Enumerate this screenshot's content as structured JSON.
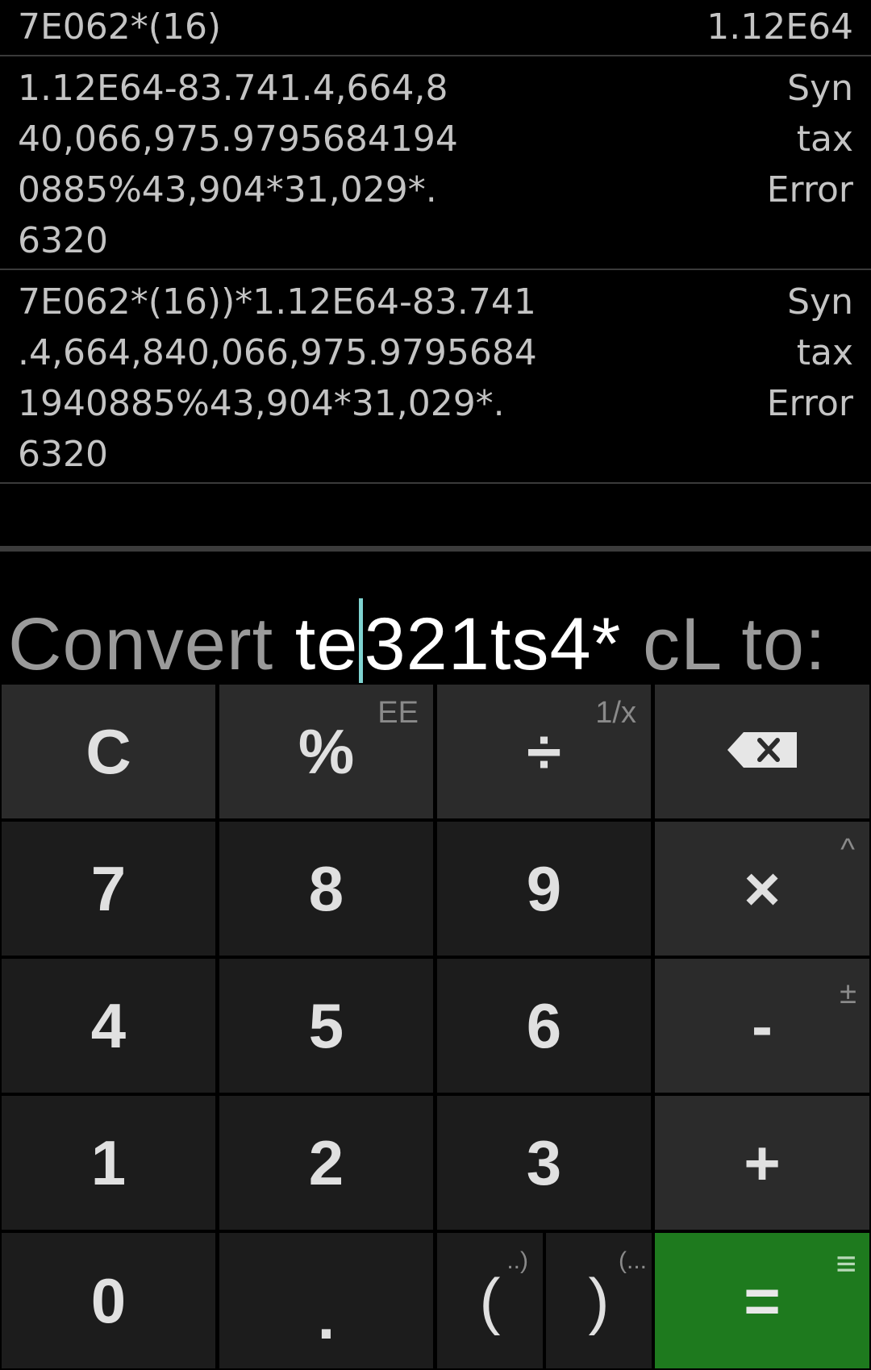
{
  "history": [
    {
      "expression": "7E062*(16)",
      "result": "1.12E64"
    },
    {
      "expression": "1.12E64-83.741.4,664,8\n40,066,975.9795684194\n0885%43,904*31,029*.\n6320",
      "result": "Syn\ntax\nError"
    },
    {
      "expression": "7E062*(16))*1.12E64-83.741\n.4,664,840,066,975.9795684\n1940885%43,904*31,029*.\n6320",
      "result": "Syn\ntax\nError"
    }
  ],
  "display": {
    "prefix": "Convert ",
    "input_before_caret": "te",
    "input_after_caret": "321ts4*",
    "suffix": " cL to:"
  },
  "keys": {
    "clear": "C",
    "percent": "%",
    "percent_alt": "EE",
    "divide": "÷",
    "divide_alt": "1/x",
    "backspace_icon": "backspace-icon",
    "seven": "7",
    "eight": "8",
    "nine": "9",
    "multiply": "×",
    "multiply_alt": "^",
    "four": "4",
    "five": "5",
    "six": "6",
    "minus": "-",
    "minus_alt": "±",
    "one": "1",
    "two": "2",
    "three": "3",
    "plus": "+",
    "zero": "0",
    "decimal": ".",
    "open_paren": "(",
    "open_paren_alt": "..)",
    "close_paren": ")",
    "close_paren_alt": "(...",
    "equals": "=",
    "equals_alt": "≡"
  },
  "colors": {
    "equals_key": "#1e7a1e",
    "caret": "#7fd3d0",
    "key_bg": "#1c1c1c",
    "top_key_bg": "#2b2b2b"
  }
}
